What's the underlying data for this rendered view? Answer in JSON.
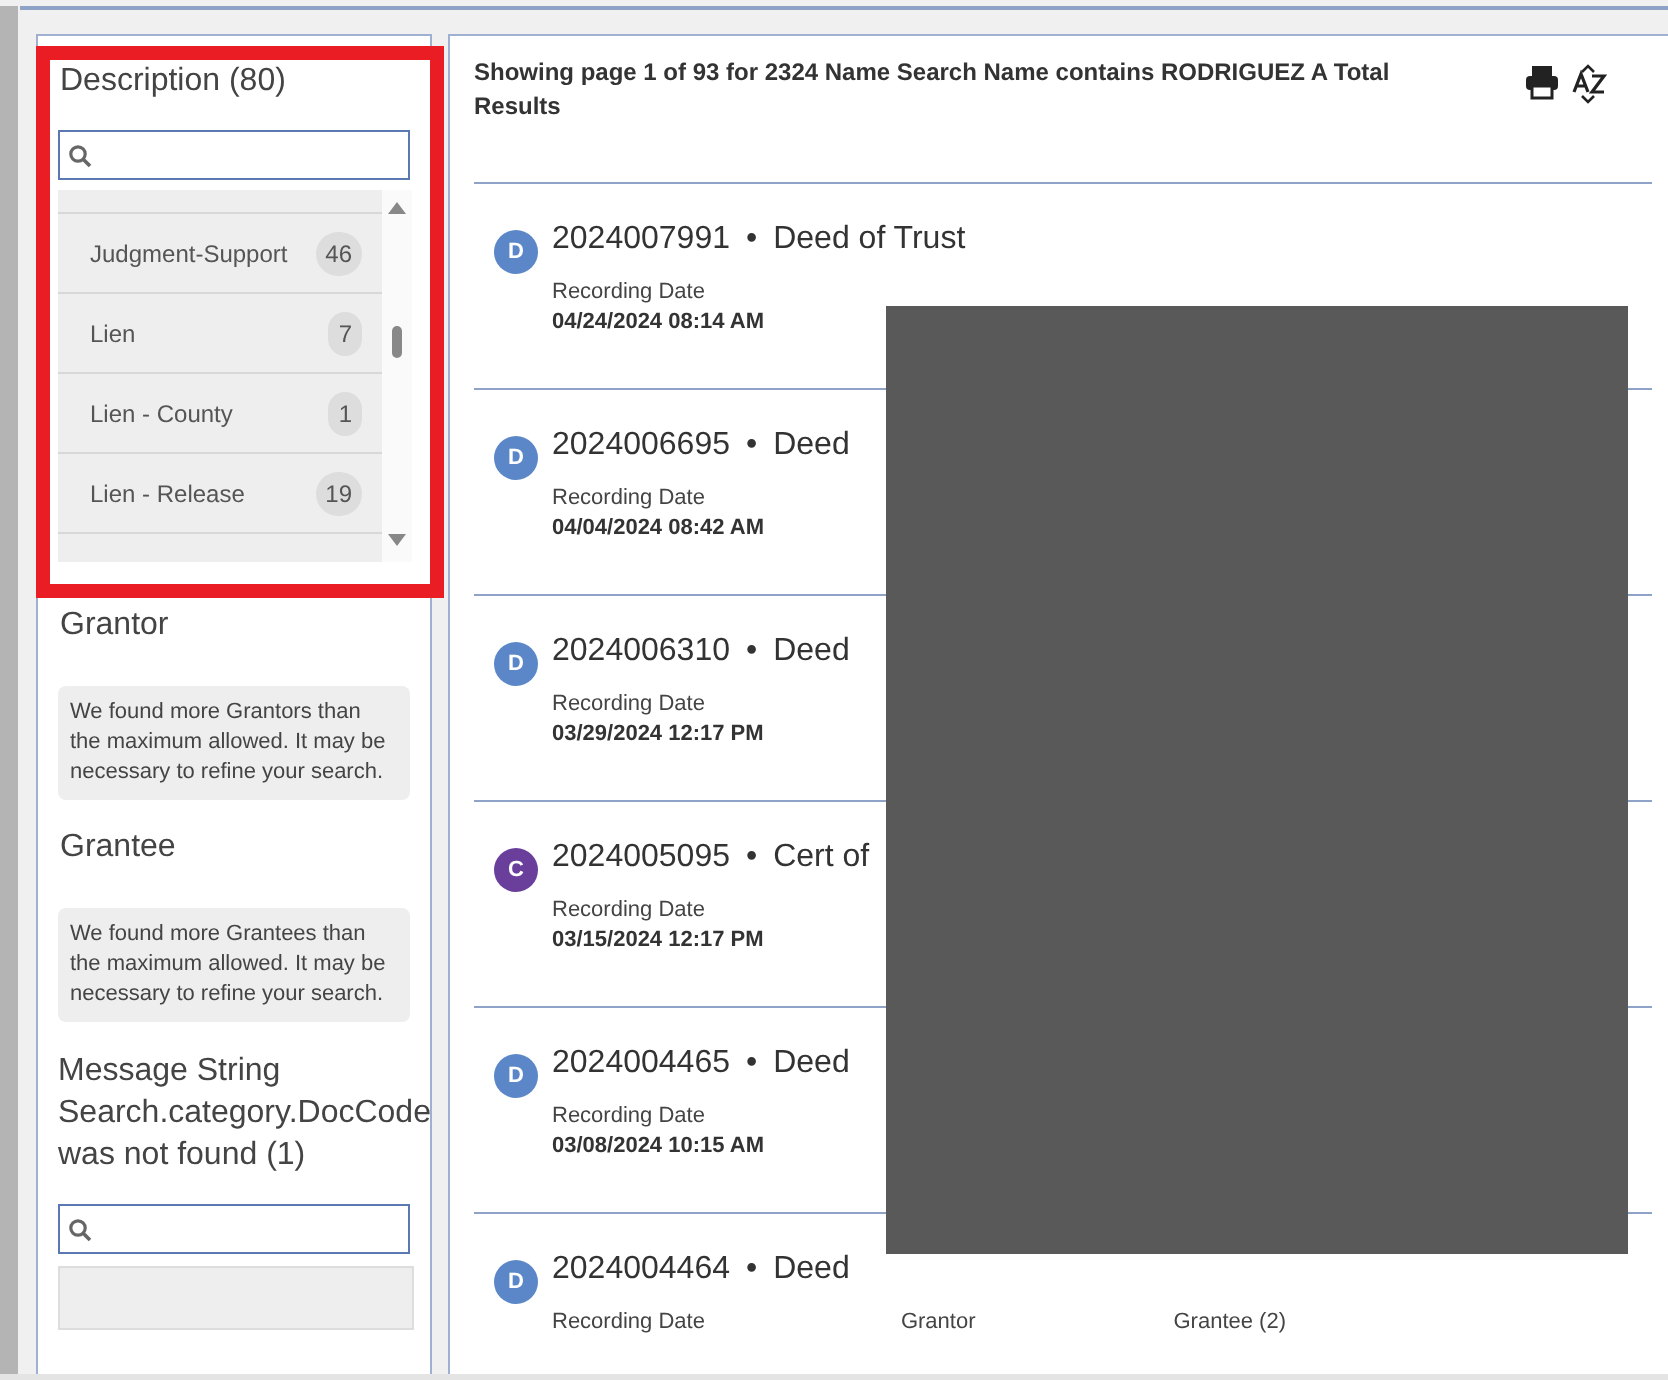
{
  "description_filter": {
    "title": "Description (80)",
    "items": [
      {
        "label": "Judgment-Support",
        "count": "46"
      },
      {
        "label": "Lien",
        "count": "7"
      },
      {
        "label": "Lien - County",
        "count": "1"
      },
      {
        "label": "Lien - Release",
        "count": "19"
      }
    ]
  },
  "notice_filters": [
    {
      "title": "Grantor",
      "notice": "We found more Grantors than the maximum allowed. It may be necessary to refine your search."
    },
    {
      "title": "Grantee",
      "notice": "We found more Grantees than the maximum allowed. It may be necessary to refine your search."
    }
  ],
  "message_filter": {
    "title": "Message String Search.category.DocCode was not found (1)"
  },
  "results": {
    "summary": "Showing page 1 of 93 for 2324 Name Search Name contains RODRIGUEZ A Total Results",
    "items": [
      {
        "initial": "D",
        "color": "#5b87c8",
        "number": "2024007991",
        "separator": "•",
        "title": "Deed of Trust",
        "date_label": "Recording Date",
        "date": "04/24/2024 08:14 AM"
      },
      {
        "initial": "D",
        "color": "#5b87c8",
        "number": "2024006695",
        "separator": "•",
        "title": "Deed",
        "date_label": "Recording Date",
        "date": "04/04/2024 08:42 AM"
      },
      {
        "initial": "D",
        "color": "#5b87c8",
        "number": "2024006310",
        "separator": "•",
        "title": "Deed",
        "date_label": "Recording Date",
        "date": "03/29/2024 12:17 PM"
      },
      {
        "initial": "C",
        "color": "#6a3f9c",
        "number": "2024005095",
        "separator": "•",
        "title": "Cert of",
        "date_label": "Recording Date",
        "date": "03/15/2024 12:17 PM"
      },
      {
        "initial": "D",
        "color": "#5b87c8",
        "number": "2024004465",
        "separator": "•",
        "title": "Deed",
        "date_label": "Recording Date",
        "date": "03/08/2024 10:15 AM"
      },
      {
        "initial": "D",
        "color": "#5b87c8",
        "number": "2024004464",
        "separator": "•",
        "title": "Deed",
        "date_label": "Recording Date",
        "columns": [
          "Grantor",
          "Grantee (2)"
        ]
      }
    ]
  }
}
